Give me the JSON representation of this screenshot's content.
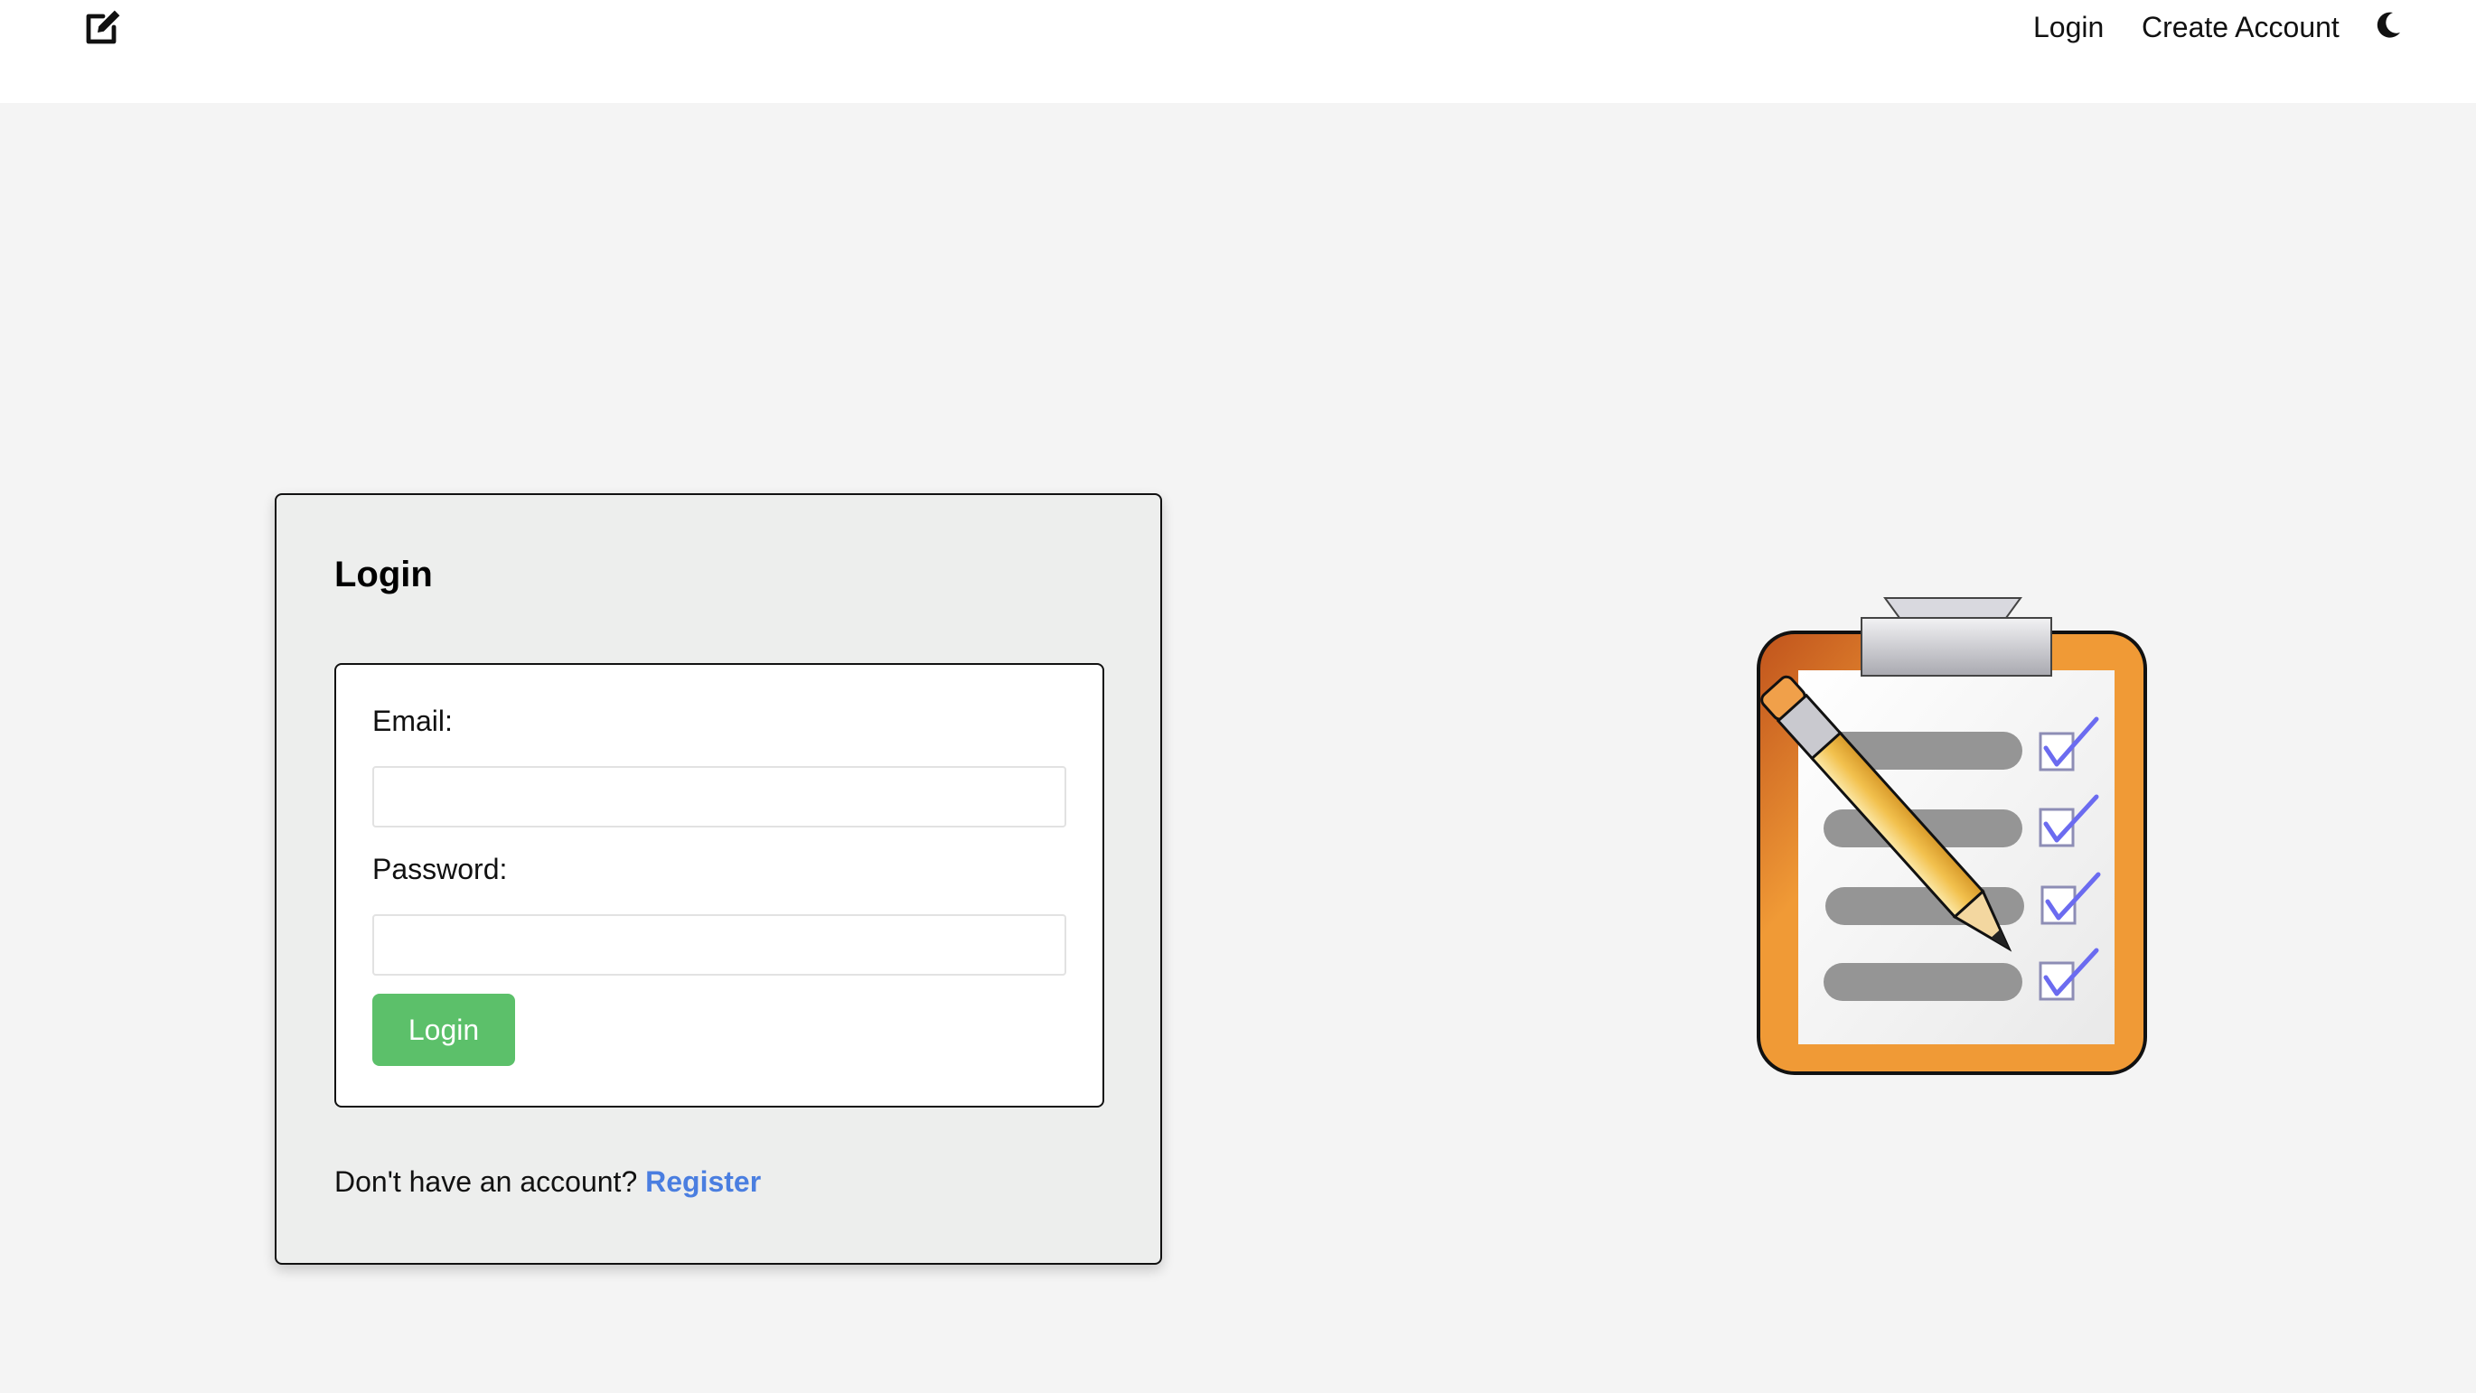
{
  "header": {
    "brand_icon": "edit-icon",
    "nav": {
      "login_label": "Login",
      "create_account_label": "Create Account"
    },
    "theme_icon": "moon-icon"
  },
  "login_card": {
    "title": "Login",
    "email_label": "Email:",
    "email_value": "",
    "password_label": "Password:",
    "password_value": "",
    "submit_label": "Login",
    "register_prompt": "Don't have an account?",
    "register_link": "Register"
  },
  "illustration": {
    "icon": "clipboard-checklist-pencil-icon"
  },
  "colors": {
    "primary_button": "#5cc06a",
    "link": "#4a7ee0",
    "page_background": "#f4f4f4",
    "card_background": "#edeeed",
    "clipboard_orange": "#f09a36",
    "check_blue": "#6b6bf0"
  }
}
